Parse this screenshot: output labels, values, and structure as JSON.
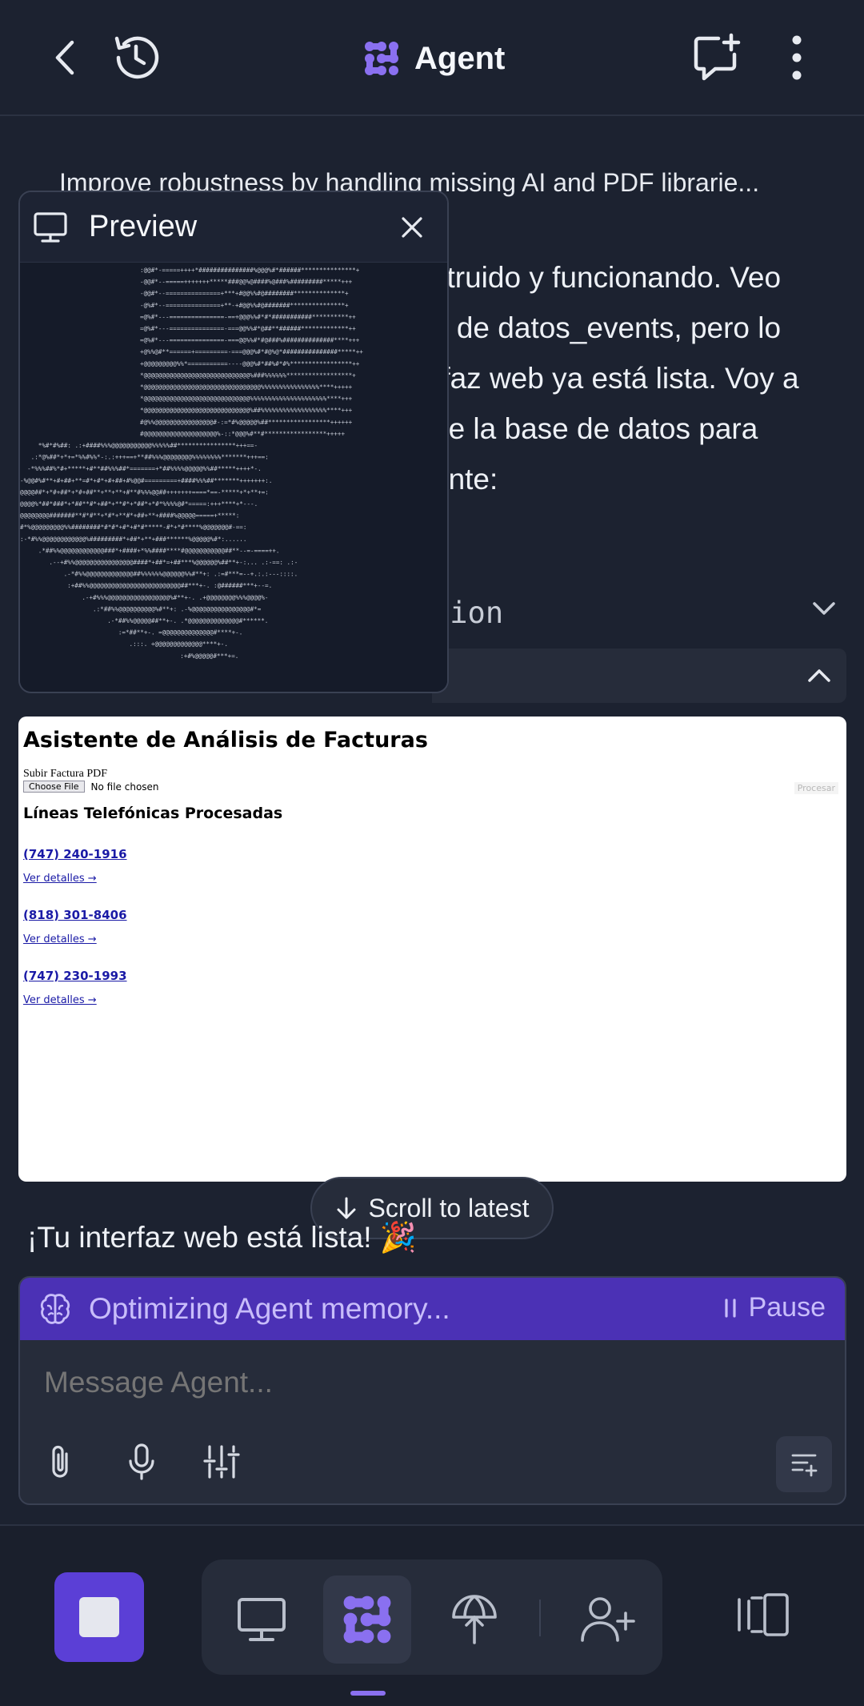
{
  "header": {
    "title": "Agent",
    "accent": "#8a70f0"
  },
  "chat": {
    "summary": "Improve robustness by handling missing AI and PDF librarie...",
    "agent_lines": [
      "struido y funcionando. Veo",
      "o de datos_events, pero lo",
      "rfaz web ya está lista. Voy a",
      "de la base de datos para",
      "ente:"
    ],
    "section_label": "tion",
    "ready_text": "¡Tu interfaz web está lista! 🎉"
  },
  "preview": {
    "title": "Preview",
    "ascii": ":@@#*-=====++++*###############%@@@%#*######***************+\n-@@#*--=====+++++++*****###@@%@####%@###%#########*****+++\n-@@#*--===============+***+#@@%%#@########**************+\n-@%#*--===============+**-+#@@%%#@#######***************+\n=@%#*---===============-==+@@@%%#*#*###########**********++\n=@%#*---===============-===@@%%#*@##**######*************++\n=@%#*---===============-===@@%%#*#@###%##############****+++\n+@%%@#**======+=========-===@@@%#*#@%@*###############*****++\n+@@@@@@@@@%%*===========----@@@%#*##%#*#%*****************++\n*@@@@@@@@@@@@@@@@@@@@@@@@@@@@@%###%%%%%%******************+\n*@@@@@@@@@@@@@@@@@@@@@@@@@@@@@@@@%%%%%%%%%%%%%%%%****+++++\n*@@@@@@@@@@@@@@@@@@@@@@@@@@@@@%%%%%%%%%%%%%%%%%%%%%****+++\n*@@@@@@@@@@@@@@@@@@@@@@@@@@@@@%##%%%%%%%%%%%%%%%%%%****+++\n#@%%@@@@@@@@@@@@@@@@#-:=*#%@@@@@%##*****************++++++\n#@@@@@@@@@@@@@@@@@@@@%-::*@@@%#**#*****************+++++\n     *%#*#%##:    .:+####%%%@@@@@@@@@@@%%%%%##****************+++==-\n   .:*@%##*+*+=*%%#%%*-:.:+++==+**##%%%@@@@@@@@%%%%%%%%*******+++==:\n  -*%%%##%*#+*****+#**##%%%##*=======+*##%%%%@@@@@%%##*****++++*-.\n-%@@#%#**+#+##+**=#*+#*+#+##+#%@@#=========+####%%%##*******+++++++:.\n@@@@##*+*#+##*+*#+##**+**+**+#**#%%%@@##+++++++====*==-*****+*+**+=:\n@@@@%*##*###*+*##**#*+##*+**#*+*##*+*#*%%%%@#*=====:+++****+*---.\n@@@@@@@@#######**#*#**+*#*+**#*+##+**+####%@@@@@=====+*****:\n#*%@@@@@@@@@%%########*#*#*+#*+#*#*****-#*+*#****%@@@@@@@#-==:\n:-*#%%@@@@@@@@@@@@%#########*+##*+**+###******%@@@@@%#*:......\n     .*##%%@@@@@@@@@@@@###*+####+*%%####****#@@@@@@@@@@@##**--=-====++.\n        .--+#%%@@@@@@@@@@@@@@@@####*+##*=+##***%@@@@@@%##**+-:...    .:-==:           .:-\n            .-*#%%@@@@@@@@@@@@@##%%%%%%@@@@@@%%#**+:  .:=#***=--+.:.:---::::.\n             :+##%%@@@@@@@@@@@@@@@@@@@@@@@@@##***+-.  :@######***+--=.\n                 .-+#%%%@@@@@@@@@@@@@@@@@%#**+-.  .+@@@@@@@@%%%@@@@%-\n                    .:*##%%@@@@@@@@@@%#**+:  .-%@@@@@@@@@@@@@@@@#*=\n                        .-*##%%@@@@@##**+-. .*@@@@@@@@@@@@@@#******.\n                           :=*##**+-.    =@@@@@@@@@@@@@@#****+-.\n                              .:::.      +@@@@@@@@@@@@@****+-.\n                                            :+#%@@@@@#***+=."
  },
  "web_preview": {
    "title": "Asistente de Análisis de Facturas",
    "upload_label": "Subir Factura PDF",
    "choose_file": "Choose File",
    "no_file": "No file chosen",
    "process_button": "Procesar",
    "subtitle": "Líneas Telefónicas Procesadas",
    "lines": [
      {
        "phone": "(747) 240-1916",
        "detail": "Ver detalles →"
      },
      {
        "phone": "(818) 301-8406",
        "detail": "Ver detalles →"
      },
      {
        "phone": "(747) 230-1993",
        "detail": "Ver detalles →"
      }
    ]
  },
  "scroll_pill": {
    "label": "Scroll to latest"
  },
  "composer": {
    "memory_text": "Optimizing Agent memory...",
    "pause_label": "Pause",
    "placeholder": "Message Agent...",
    "banner_color": "#4b31b5"
  },
  "icons": [
    "back-icon",
    "history-icon",
    "agent-logo-icon",
    "new-chat-icon",
    "more-vertical-icon",
    "monitor-icon",
    "close-icon",
    "chevron-down-icon",
    "chevron-up-icon",
    "arrow-down-icon",
    "brain-icon",
    "pause-icon",
    "paperclip-icon",
    "microphone-icon",
    "sliders-icon",
    "context-icon",
    "stop-icon",
    "agent-icon",
    "deploy-icon",
    "invite-icon",
    "layout-icon"
  ]
}
